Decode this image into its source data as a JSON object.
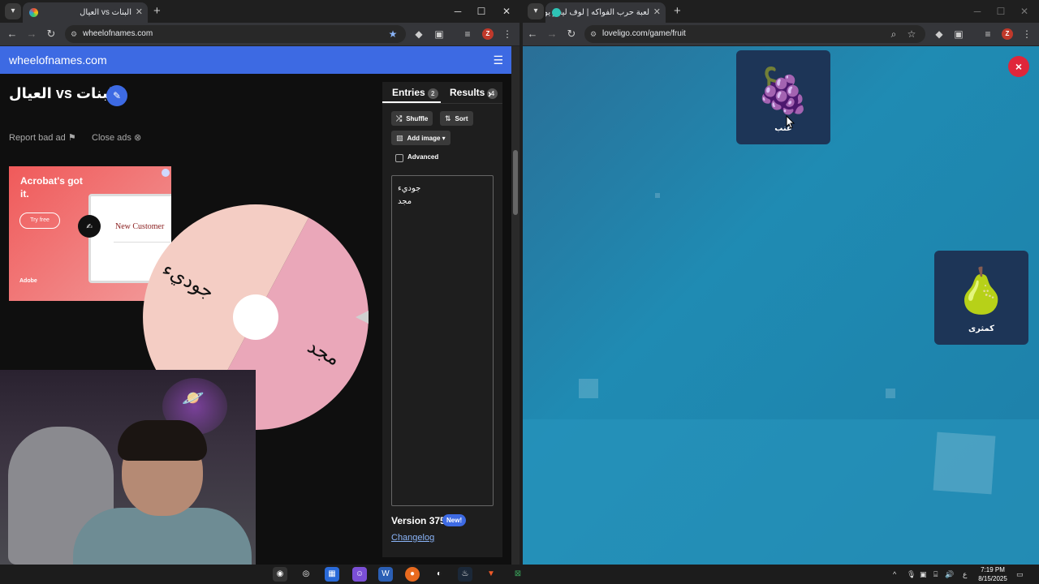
{
  "left_window": {
    "tab_title": "البنات vs العيال",
    "url": "wheelofnames.com",
    "app_title": "wheelofnames.com",
    "wheel_title": "البنات vs العيال",
    "report_bad_ad": "Report bad ad",
    "close_ads": "Close ads",
    "ad": {
      "headline": "Acrobat's got it.",
      "cta": "Try free",
      "brand": "Adobe",
      "form_title": "New Customer"
    },
    "wheel_segments": [
      {
        "label": "مجد",
        "color": "#eaa7b9"
      },
      {
        "label": "جوديء",
        "color": "#f4cdc4"
      }
    ],
    "panel": {
      "entries_tab": "Entries",
      "entries_count": "2",
      "results_tab": "Results",
      "results_count": "4",
      "shuffle": "Shuffle",
      "sort": "Sort",
      "add_image": "Add image",
      "advanced": "Advanced",
      "entries": [
        "جوديء",
        "مجد"
      ],
      "version": "Version 375",
      "new_badge": "New!",
      "changelog": "Changelog"
    }
  },
  "right_window": {
    "tab_title": "لعبة حرب الفواكه | لوف ليجو يوفر",
    "url": "loveligo.com/game/fruit",
    "cards": [
      {
        "emoji": "🍇",
        "label": "عنب"
      },
      {
        "emoji": "🍐",
        "label": "كمثرى"
      }
    ],
    "close_symbol": "×"
  },
  "taskbar": {
    "time": "7:19 PM",
    "date": "8/15/2025",
    "lang": "ع"
  },
  "colors": {
    "wheel_blue": "#3d6ae3",
    "game_bg": "#1f8bb3",
    "close_red": "#e0263a",
    "card_navy": "#1d3557"
  }
}
